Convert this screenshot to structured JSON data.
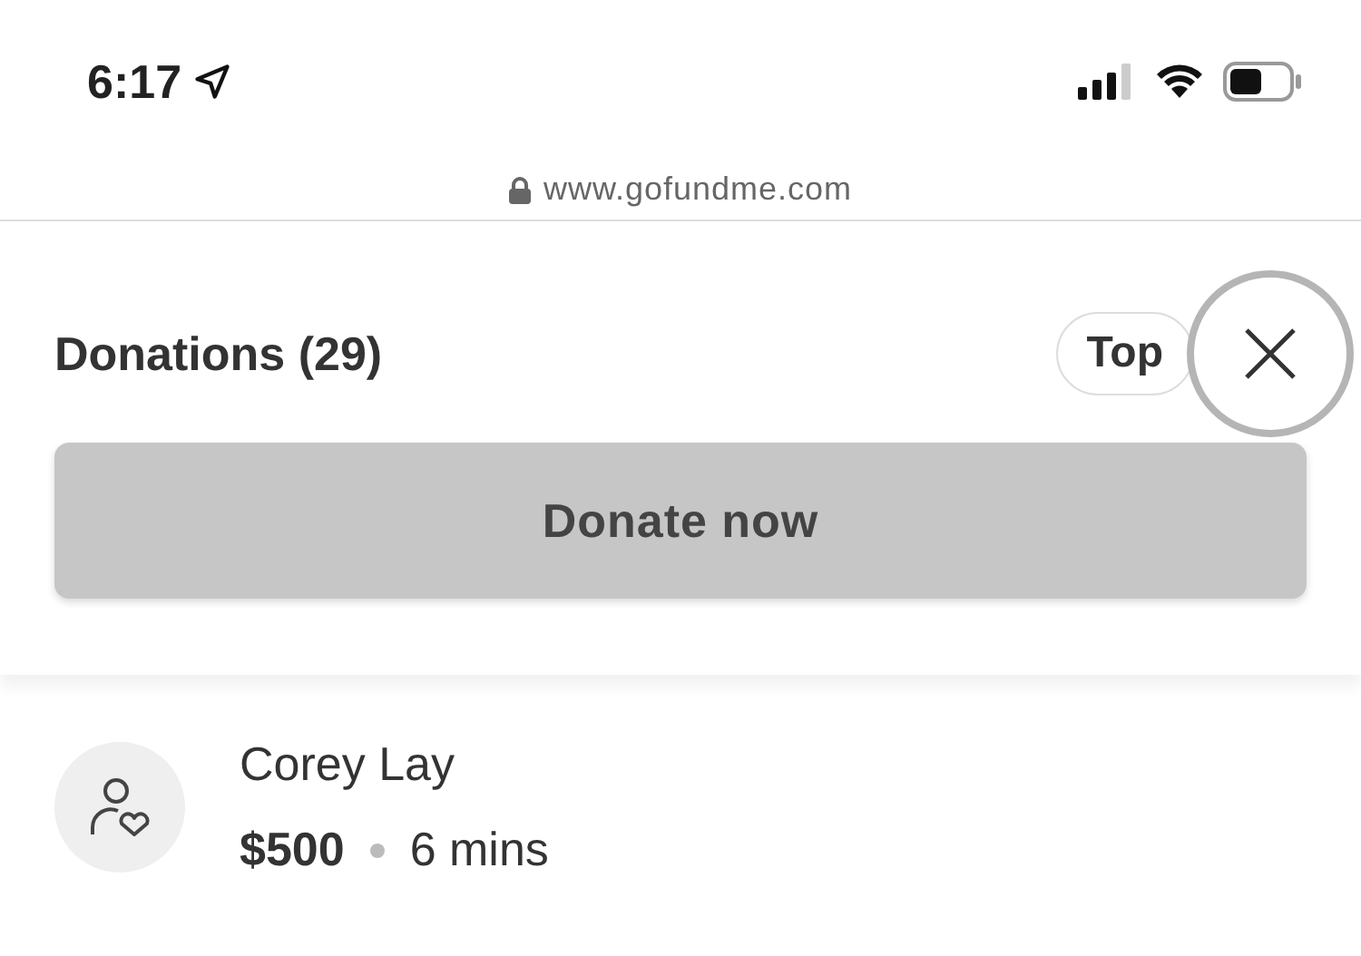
{
  "status_bar": {
    "time": "6:17"
  },
  "address_bar": {
    "url": "www.gofundme.com"
  },
  "header": {
    "title": "Donations (29)",
    "sort_button": "Top"
  },
  "donate_button": "Donate now",
  "donations": [
    {
      "name": "Corey Lay",
      "amount": "$500",
      "time": "6 mins"
    }
  ]
}
